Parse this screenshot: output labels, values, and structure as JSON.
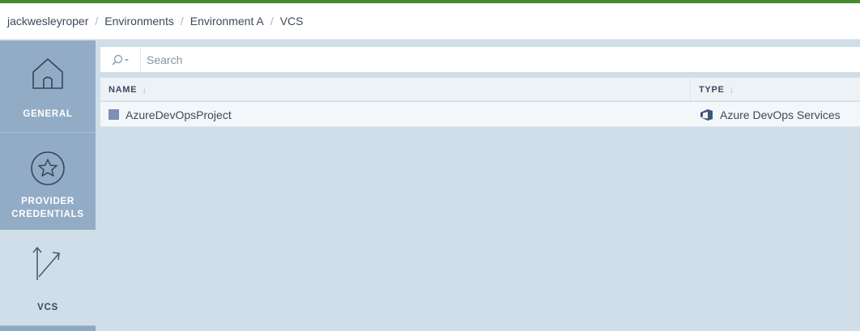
{
  "colors": {
    "accent_bar": "#4a8a2e",
    "sidebar_bg": "#92acc6",
    "active_nav_bg": "#cfdee9",
    "content_bg": "#cfdee9",
    "repo_swatch": "#7d8fb3"
  },
  "breadcrumb": {
    "items": [
      "jackwesleyroper",
      "Environments",
      "Environment A",
      "VCS"
    ],
    "separator": "/"
  },
  "sidebar": {
    "items": [
      {
        "label": "GENERAL",
        "icon": "house-icon",
        "active": false
      },
      {
        "label_line1": "PROVIDER",
        "label_line2": "CREDENTIALS",
        "icon": "star-circle-icon",
        "active": false
      },
      {
        "label": "VCS",
        "icon": "branch-arrows-icon",
        "active": true
      }
    ]
  },
  "search": {
    "placeholder": "Search",
    "value": "",
    "icon": "search-icon"
  },
  "table": {
    "columns": [
      {
        "label": "NAME",
        "sort_icon": "↓"
      },
      {
        "label": "TYPE",
        "sort_icon": "↓"
      }
    ],
    "rows": [
      {
        "name": "AzureDevOpsProject",
        "type": "Azure DevOps Services",
        "type_icon": "azure-devops-icon"
      }
    ]
  }
}
